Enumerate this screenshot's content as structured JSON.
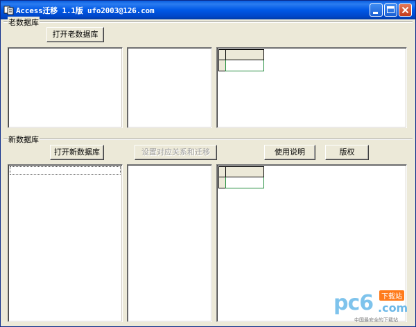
{
  "window": {
    "title": "Access迁移 1.1版 ufo2003@126.com"
  },
  "old_db": {
    "group_label": "老数据库",
    "open_button": "打开老数据库"
  },
  "new_db": {
    "group_label": "新数据库",
    "open_button": "打开新数据库",
    "mapping_button": "设置对应关系和迁移",
    "help_button": "使用说明",
    "copyright_button": "版权"
  },
  "watermark": {
    "logo": "pc6",
    "domain": ".com",
    "tag": "下载站",
    "slogan": "中国最安全的下载站"
  },
  "colors": {
    "titlebar": "#0058e6",
    "window_bg": "#ece9d8",
    "grid_selection": "#1e8a3a"
  }
}
